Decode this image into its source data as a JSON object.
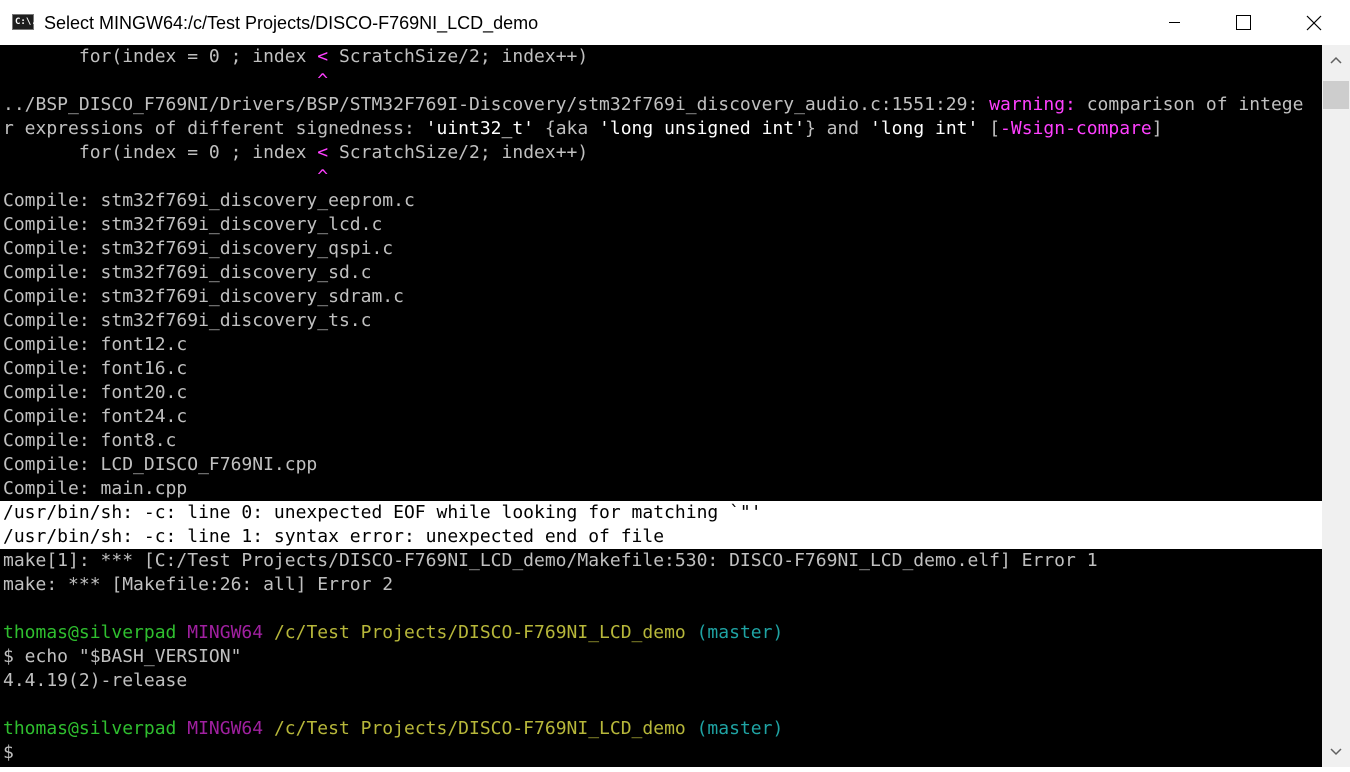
{
  "window": {
    "title": "Select MINGW64:/c/Test Projects/DISCO-F769NI_LCD_demo",
    "icon": "console-icon",
    "icon_glyph": "C:\\.",
    "controls": [
      "minimize-icon",
      "maximize-icon",
      "close-icon"
    ]
  },
  "terminal": {
    "colors": {
      "background": "#000000",
      "text": "#c0c0c0",
      "warning": "#ff40ff",
      "user": "#2fbf2f",
      "msystem": "#a020a0",
      "path": "#b7b73a",
      "branch": "#1fa3a3",
      "selection": "#ffffff"
    },
    "lines": {
      "l1": {
        "a": "       for(index = 0 ; index ",
        "b": "<",
        "c": " ScratchSize/2; index++)"
      },
      "l2": {
        "caret": "                             ^"
      },
      "l3": {
        "a": "../BSP_DISCO_F769NI/Drivers/BSP/STM32F769I-Discovery/stm32f769i_discovery_audio.c:1551:29: ",
        "warn": "warning:",
        "b": " comparison of intege"
      },
      "l4": {
        "a": "r expressions of different signedness: ",
        "q1": "'uint32_t'",
        "b": " {aka ",
        "q2": "'long unsigned int'",
        "c": "} and ",
        "q3": "'long int'",
        "d": " [",
        "flag": "-Wsign-compare",
        "e": "]"
      },
      "l5": {
        "a": "       for(index = 0 ; index ",
        "b": "<",
        "c": " ScratchSize/2; index++)"
      },
      "l6": {
        "caret": "                             ^"
      },
      "compile": [
        "Compile: stm32f769i_discovery_eeprom.c",
        "Compile: stm32f769i_discovery_lcd.c",
        "Compile: stm32f769i_discovery_qspi.c",
        "Compile: stm32f769i_discovery_sd.c",
        "Compile: stm32f769i_discovery_sdram.c",
        "Compile: stm32f769i_discovery_ts.c",
        "Compile: font12.c",
        "Compile: font16.c",
        "Compile: font20.c",
        "Compile: font24.c",
        "Compile: font8.c",
        "Compile: LCD_DISCO_F769NI.cpp",
        "Compile: main.cpp"
      ],
      "selected1": "/usr/bin/sh: -c: line 0: unexpected EOF while looking for matching `\"'",
      "selected2": "/usr/bin/sh: -c: line 1: syntax error: unexpected end of file",
      "make1": "make[1]: *** [C:/Test Projects/DISCO-F769NI_LCD_demo/Makefile:530: DISCO-F769NI_LCD_demo.elf] Error 1",
      "make2": "make: *** [Makefile:26: all] Error 2",
      "prompt1": {
        "user": "thomas@silverpad",
        "msys": "MINGW64",
        "path": "/c/Test Projects/DISCO-F769NI_LCD_demo",
        "branch": "(master)"
      },
      "cmd": "$ echo \"$BASH_VERSION\"",
      "output": "4.4.19(2)-release",
      "prompt2": {
        "user": "thomas@silverpad",
        "msys": "MINGW64",
        "path": "/c/Test Projects/DISCO-F769NI_LCD_demo",
        "branch": "(master)"
      },
      "cursor_line": "$"
    }
  },
  "scrollbar": {
    "up_icon": "scroll-up-arrow-icon",
    "down_icon": "scroll-down-arrow-icon"
  }
}
